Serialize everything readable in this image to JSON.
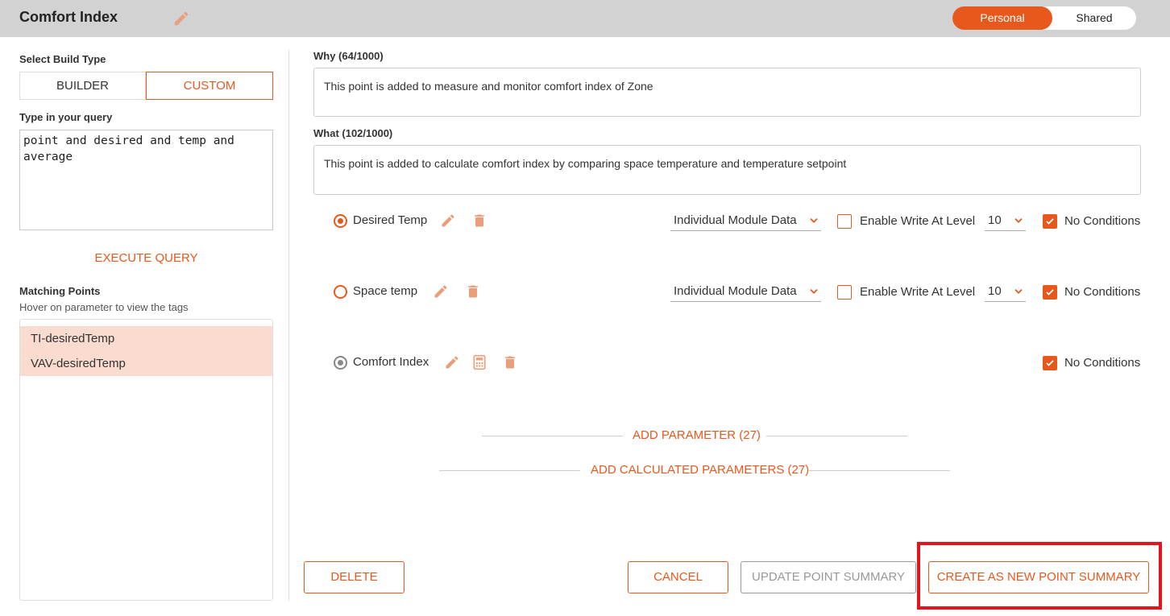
{
  "header": {
    "title": "Comfort Index",
    "toggle_personal": "Personal",
    "toggle_shared": "Shared"
  },
  "left": {
    "build_type_label": "Select Build Type",
    "builder_label": "BUILDER",
    "custom_label": "CUSTOM",
    "selected_build_type": "CUSTOM",
    "query_label": "Type in your query",
    "query_value": "point and desired and temp and average",
    "execute_label": "EXECUTE QUERY",
    "matching_label": "Matching Points",
    "matching_hint": "Hover on parameter to view the tags",
    "points": [
      "TI-desiredTemp",
      "VAV-desiredTemp"
    ]
  },
  "why": {
    "label": "Why (64/1000)",
    "value": "This point is added to measure and monitor comfort index of Zone"
  },
  "what": {
    "label": "What (102/1000)",
    "value": "This point is added to calculate comfort index by comparing space temperature and temperature setpoint"
  },
  "params": [
    {
      "name": "Desired Temp",
      "selected": true,
      "data_source": "Individual Module Data",
      "enable_write_label": "Enable Write At Level",
      "enable_write": false,
      "level": "10",
      "no_conditions_label": "No Conditions",
      "no_conditions": true
    },
    {
      "name": "Space temp",
      "selected": false,
      "data_source": "Individual Module Data",
      "enable_write_label": "Enable Write At Level",
      "enable_write": false,
      "level": "10",
      "no_conditions_label": "No Conditions",
      "no_conditions": true
    },
    {
      "name": "Comfort Index",
      "selected": true,
      "calculated": true,
      "no_conditions_label": "No Conditions",
      "no_conditions": true
    }
  ],
  "add_parameter": "ADD PARAMETER (27)",
  "add_calculated": "ADD CALCULATED PARAMETERS (27)",
  "buttons": {
    "delete": "DELETE",
    "cancel": "CANCEL",
    "update": "UPDATE POINT SUMMARY",
    "create": "CREATE AS NEW POINT SUMMARY"
  },
  "colors": {
    "accent": "#e8581c",
    "highlight_box": "#e3141e",
    "selected_row": "#f9dbd0",
    "header_bg": "#d2d2d2"
  }
}
